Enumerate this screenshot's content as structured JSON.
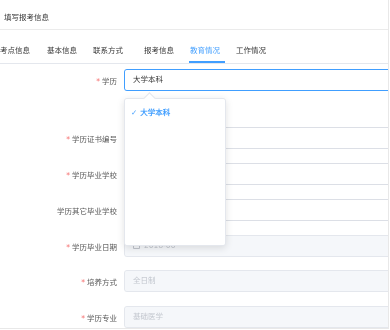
{
  "page": {
    "title": "填写报考信息"
  },
  "tabs": [
    {
      "label": "考点信息",
      "active": false
    },
    {
      "label": "基本信息",
      "active": false
    },
    {
      "label": "联系方式",
      "active": false
    },
    {
      "label": "报考信息",
      "active": false
    },
    {
      "label": "教育情况",
      "active": true
    },
    {
      "label": "工作情况",
      "active": false
    }
  ],
  "form": {
    "education": {
      "label": "学历",
      "required": true,
      "value": "大学本科"
    },
    "certificate_no": {
      "label": "学历证书编号",
      "required": true,
      "value": ""
    },
    "graduate_school": {
      "label": "学历毕业学校",
      "required": true,
      "value": ""
    },
    "other_school": {
      "label": "学历其它毕业学校",
      "required": false,
      "value": ""
    },
    "graduate_date": {
      "label": "学历毕业日期",
      "required": true,
      "value": "2018-06"
    },
    "study_mode": {
      "label": "培养方式",
      "required": true,
      "value": "全日制"
    },
    "major": {
      "label": "学历专业",
      "required": true,
      "value": "基础医学"
    }
  },
  "dropdown": {
    "options": [
      {
        "label": "大学本科",
        "selected": true
      }
    ],
    "check_glyph": "✓"
  },
  "colors": {
    "accent": "#409eff",
    "required": "#f56c6c",
    "border": "#dcdfe6",
    "disabled_bg": "#f5f7fa"
  }
}
